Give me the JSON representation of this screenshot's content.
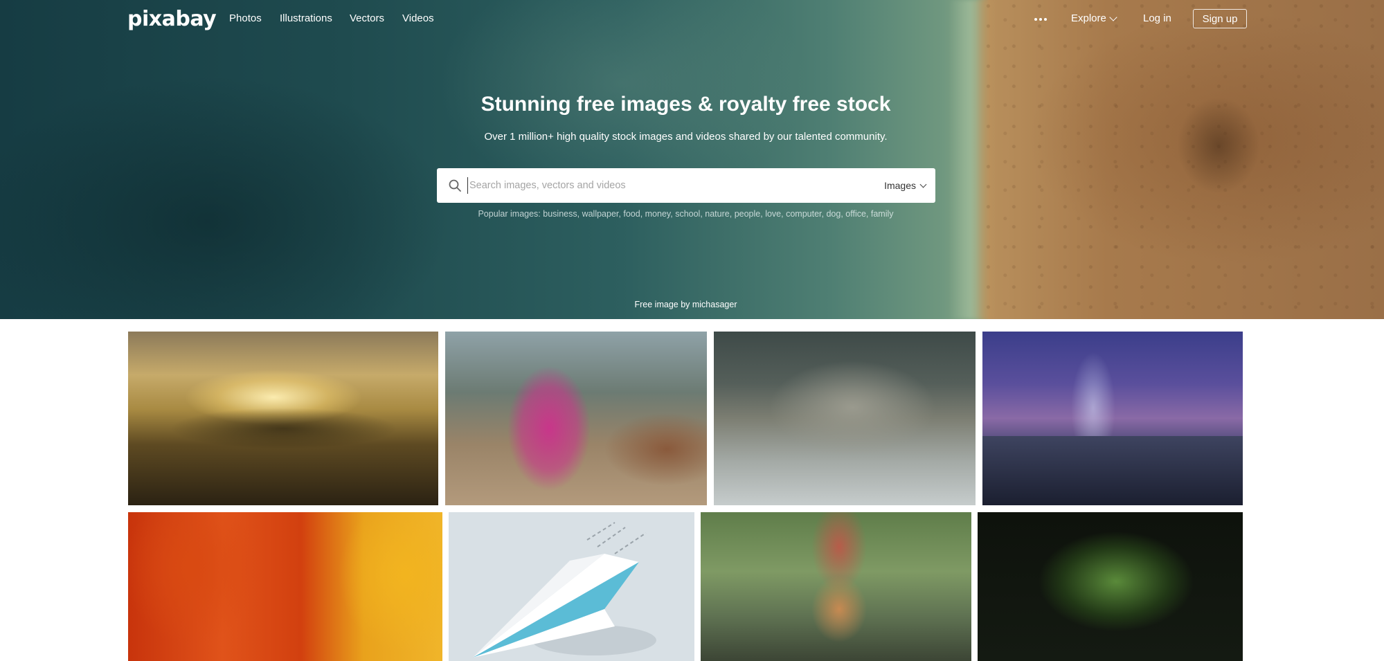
{
  "nav": {
    "logo": "pixabay",
    "links": [
      "Photos",
      "Illustrations",
      "Vectors",
      "Videos"
    ],
    "more_icon": "more-dots-icon",
    "explore_label": "Explore",
    "login_label": "Log in",
    "signup_label": "Sign up"
  },
  "hero": {
    "title": "Stunning free images & royalty free stock",
    "subtitle": "Over 1 million+ high quality stock images and videos shared by our talented community.",
    "credit": "Free image by michasager"
  },
  "search": {
    "placeholder": "Search images, vectors and videos",
    "value": "",
    "type_selected": "Images",
    "icon": "search-icon"
  },
  "popular": {
    "label": "Popular images:",
    "tags": [
      "business",
      "wallpaper",
      "food",
      "money",
      "school",
      "nature",
      "people",
      "love",
      "computer",
      "dog",
      "office",
      "family"
    ]
  }
}
